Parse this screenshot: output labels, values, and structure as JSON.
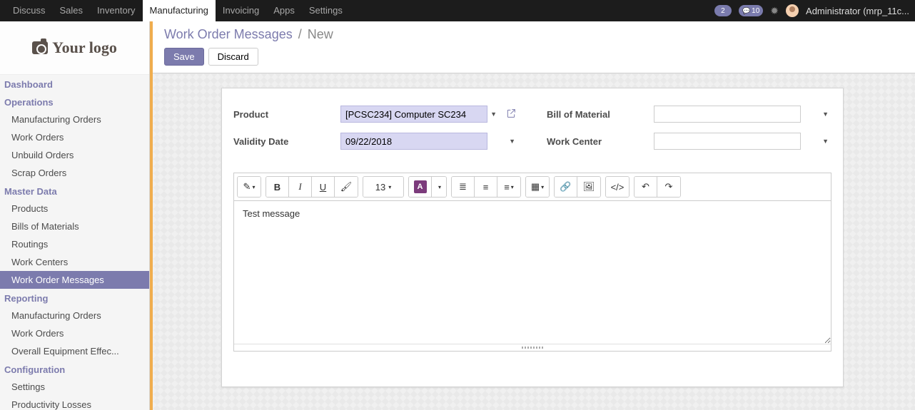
{
  "navbar": {
    "items": [
      "Discuss",
      "Sales",
      "Inventory",
      "Manufacturing",
      "Invoicing",
      "Apps",
      "Settings"
    ],
    "active_index": 3,
    "badges": {
      "counter": "2",
      "messages": "10"
    },
    "user_label": "Administrator (mrp_11c..."
  },
  "logo_text": "Your logo",
  "sidebar": {
    "sections": [
      {
        "title": "Dashboard",
        "items": []
      },
      {
        "title": "Operations",
        "items": [
          "Manufacturing Orders",
          "Work Orders",
          "Unbuild Orders",
          "Scrap Orders"
        ]
      },
      {
        "title": "Master Data",
        "items": [
          "Products",
          "Bills of Materials",
          "Routings",
          "Work Centers",
          "Work Order Messages"
        ]
      },
      {
        "title": "Reporting",
        "items": [
          "Manufacturing Orders",
          "Work Orders",
          "Overall Equipment Effec..."
        ]
      },
      {
        "title": "Configuration",
        "items": [
          "Settings",
          "Productivity Losses"
        ]
      }
    ],
    "active": "Work Order Messages"
  },
  "breadcrumb": {
    "root": "Work Order Messages",
    "current": "New"
  },
  "buttons": {
    "save": "Save",
    "discard": "Discard"
  },
  "form": {
    "left": {
      "product_label": "Product",
      "product_value": "[PCSC234] Computer SC234",
      "validity_label": "Validity Date",
      "validity_value": "09/22/2018"
    },
    "right": {
      "bom_label": "Bill of Material",
      "bom_value": "",
      "workcenter_label": "Work Center",
      "workcenter_value": ""
    },
    "font_size_label": "13",
    "editor_text": "Test message"
  }
}
